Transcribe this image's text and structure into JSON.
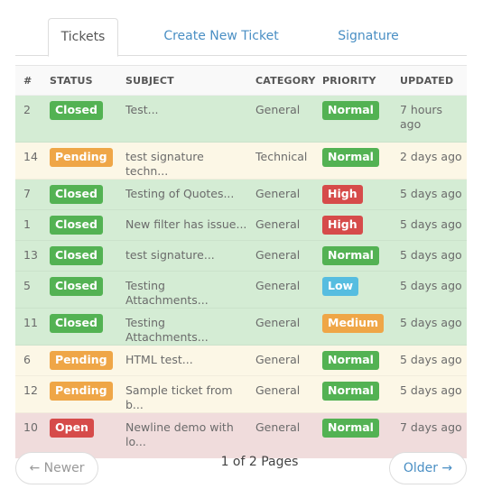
{
  "tabs": [
    {
      "label": "Tickets",
      "active": true
    },
    {
      "label": "Create New Ticket",
      "active": false
    },
    {
      "label": "Signature",
      "active": false
    }
  ],
  "table": {
    "headers": [
      "#",
      "STATUS",
      "SUBJECT",
      "CATEGORY",
      "PRIORITY",
      "UPDATED"
    ],
    "rows": [
      {
        "id": "2",
        "status": "Closed",
        "subject": "Test...",
        "category": "General",
        "priority": "Normal",
        "updated": "7 hours ago"
      },
      {
        "id": "14",
        "status": "Pending",
        "subject": "test signature techn...",
        "category": "Technical",
        "priority": "Normal",
        "updated": "2 days ago"
      },
      {
        "id": "7",
        "status": "Closed",
        "subject": "Testing of Quotes...",
        "category": "General",
        "priority": "High",
        "updated": "5 days ago"
      },
      {
        "id": "1",
        "status": "Closed",
        "subject": "New filter has issue...",
        "category": "General",
        "priority": "High",
        "updated": "5 days ago"
      },
      {
        "id": "13",
        "status": "Closed",
        "subject": "test signature...",
        "category": "General",
        "priority": "Normal",
        "updated": "5 days ago"
      },
      {
        "id": "5",
        "status": "Closed",
        "subject": "Testing Attachments...",
        "category": "General",
        "priority": "Low",
        "updated": "5 days ago"
      },
      {
        "id": "11",
        "status": "Closed",
        "subject": "Testing Attachments...",
        "category": "General",
        "priority": "Medium",
        "updated": "5 days ago"
      },
      {
        "id": "6",
        "status": "Pending",
        "subject": "HTML test...",
        "category": "General",
        "priority": "Normal",
        "updated": "5 days ago"
      },
      {
        "id": "12",
        "status": "Pending",
        "subject": "Sample ticket from b...",
        "category": "General",
        "priority": "Normal",
        "updated": "5 days ago"
      },
      {
        "id": "10",
        "status": "Open",
        "subject": "Newline demo with lo...",
        "category": "General",
        "priority": "Normal",
        "updated": "7 days ago"
      }
    ]
  },
  "colors": {
    "status": {
      "Closed": "#53b253",
      "Pending": "#efa647",
      "Open": "#d64b4a"
    },
    "priority": {
      "Normal": "#53b253",
      "High": "#d64b4a",
      "Low": "#56bde0",
      "Medium": "#efa647"
    },
    "row_bg": {
      "Closed": "#d4ecd4",
      "Pending": "#fcf7e6",
      "Open": "#f0dcdc"
    },
    "link": "#4a8fc4"
  },
  "pager": {
    "newer_label": "← Newer",
    "older_label": "Older →",
    "info": "1 of 2 Pages"
  }
}
